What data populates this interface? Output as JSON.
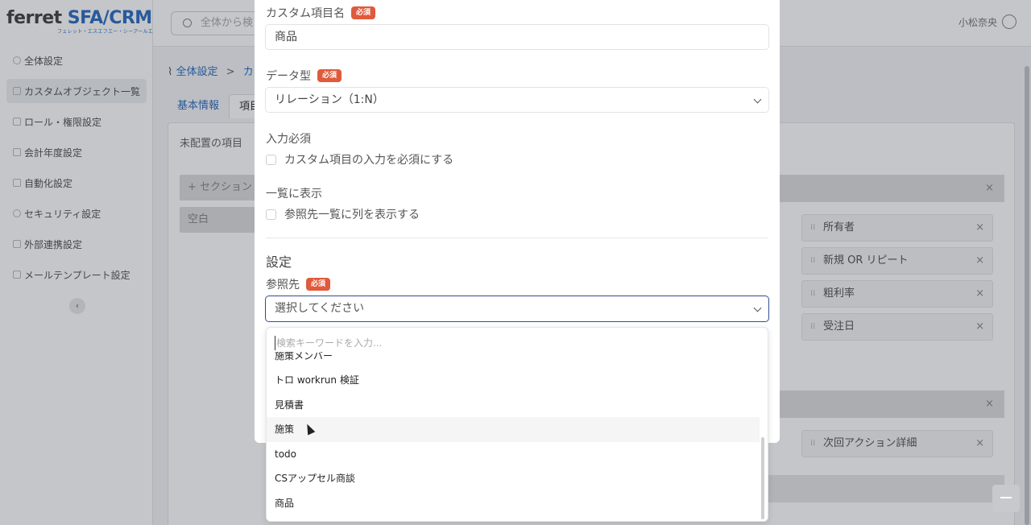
{
  "app": {
    "logo_main_a": "ferret ",
    "logo_main_b": "SFA/CRM",
    "logo_sub": "フェレット・エスエフエー・シーアールエム",
    "search_placeholder": "全体から検",
    "user_name": "小松奈央"
  },
  "sidebar": {
    "items": [
      {
        "label": "全体設定"
      },
      {
        "label": "カスタムオブジェクト一覧"
      },
      {
        "label": "ロール・権限設定"
      },
      {
        "label": "会計年度設定"
      },
      {
        "label": "自動化設定"
      },
      {
        "label": "セキュリティ設定"
      },
      {
        "label": "外部連携設定"
      },
      {
        "label": "メールテンプレート設定"
      }
    ],
    "collapse_glyph": "‹"
  },
  "breadcrumb": {
    "root": "全体設定",
    "sep": ">",
    "next": "カ"
  },
  "tabs": [
    {
      "label": "基本情報"
    },
    {
      "label": "項目"
    }
  ],
  "layout_panel": {
    "unplaced_label": "未配置の項目",
    "section_add": "+ セクション",
    "blank": "空白",
    "fields_col_right": [
      "所有者",
      "新規 OR リピート",
      "粗利率",
      "受注日"
    ],
    "field_lower": "次回アクション詳細",
    "remove_glyph": "×"
  },
  "modal": {
    "custom_item_name_label": "カスタム項目名",
    "custom_item_name_value": "商品",
    "data_type_label": "データ型",
    "data_type_value": "リレーション（1:N）",
    "required_badge": "必須",
    "input_required_label": "入力必須",
    "input_required_option": "カスタム項目の入力を必須にする",
    "show_in_list_label": "一覧に表示",
    "show_in_list_option": "参照先一覧に列を表示する",
    "settings_title": "設定",
    "reference_label": "参照先",
    "reference_placeholder": "選択してください"
  },
  "dropdown": {
    "search_placeholder": "検索キーワードを入力...",
    "options": [
      "施策メンバー",
      "トロ workrun 検証",
      "見積書",
      "施策",
      "todo",
      "CSアップセル商談",
      "商品"
    ]
  }
}
